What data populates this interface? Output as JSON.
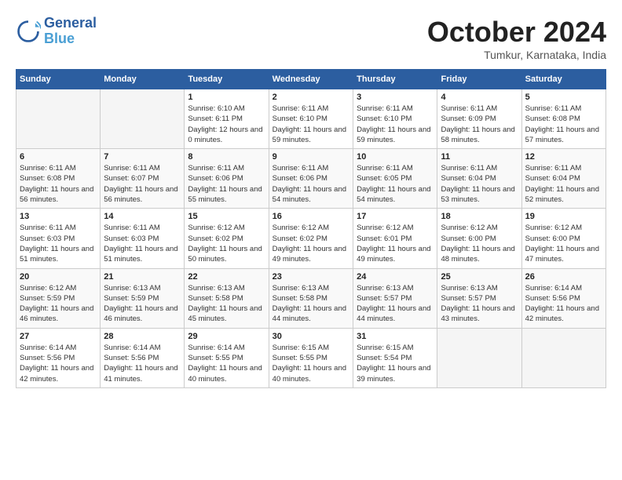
{
  "header": {
    "logo_line1": "General",
    "logo_line2": "Blue",
    "month": "October 2024",
    "location": "Tumkur, Karnataka, India"
  },
  "days_of_week": [
    "Sunday",
    "Monday",
    "Tuesday",
    "Wednesday",
    "Thursday",
    "Friday",
    "Saturday"
  ],
  "weeks": [
    [
      {
        "day": "",
        "empty": true
      },
      {
        "day": "",
        "empty": true
      },
      {
        "day": "1",
        "sunrise": "6:10 AM",
        "sunset": "6:11 PM",
        "daylight": "12 hours and 0 minutes."
      },
      {
        "day": "2",
        "sunrise": "6:11 AM",
        "sunset": "6:10 PM",
        "daylight": "11 hours and 59 minutes."
      },
      {
        "day": "3",
        "sunrise": "6:11 AM",
        "sunset": "6:10 PM",
        "daylight": "11 hours and 59 minutes."
      },
      {
        "day": "4",
        "sunrise": "6:11 AM",
        "sunset": "6:09 PM",
        "daylight": "11 hours and 58 minutes."
      },
      {
        "day": "5",
        "sunrise": "6:11 AM",
        "sunset": "6:08 PM",
        "daylight": "11 hours and 57 minutes."
      }
    ],
    [
      {
        "day": "6",
        "sunrise": "6:11 AM",
        "sunset": "6:08 PM",
        "daylight": "11 hours and 56 minutes."
      },
      {
        "day": "7",
        "sunrise": "6:11 AM",
        "sunset": "6:07 PM",
        "daylight": "11 hours and 56 minutes."
      },
      {
        "day": "8",
        "sunrise": "6:11 AM",
        "sunset": "6:06 PM",
        "daylight": "11 hours and 55 minutes."
      },
      {
        "day": "9",
        "sunrise": "6:11 AM",
        "sunset": "6:06 PM",
        "daylight": "11 hours and 54 minutes."
      },
      {
        "day": "10",
        "sunrise": "6:11 AM",
        "sunset": "6:05 PM",
        "daylight": "11 hours and 54 minutes."
      },
      {
        "day": "11",
        "sunrise": "6:11 AM",
        "sunset": "6:04 PM",
        "daylight": "11 hours and 53 minutes."
      },
      {
        "day": "12",
        "sunrise": "6:11 AM",
        "sunset": "6:04 PM",
        "daylight": "11 hours and 52 minutes."
      }
    ],
    [
      {
        "day": "13",
        "sunrise": "6:11 AM",
        "sunset": "6:03 PM",
        "daylight": "11 hours and 51 minutes."
      },
      {
        "day": "14",
        "sunrise": "6:11 AM",
        "sunset": "6:03 PM",
        "daylight": "11 hours and 51 minutes."
      },
      {
        "day": "15",
        "sunrise": "6:12 AM",
        "sunset": "6:02 PM",
        "daylight": "11 hours and 50 minutes."
      },
      {
        "day": "16",
        "sunrise": "6:12 AM",
        "sunset": "6:02 PM",
        "daylight": "11 hours and 49 minutes."
      },
      {
        "day": "17",
        "sunrise": "6:12 AM",
        "sunset": "6:01 PM",
        "daylight": "11 hours and 49 minutes."
      },
      {
        "day": "18",
        "sunrise": "6:12 AM",
        "sunset": "6:00 PM",
        "daylight": "11 hours and 48 minutes."
      },
      {
        "day": "19",
        "sunrise": "6:12 AM",
        "sunset": "6:00 PM",
        "daylight": "11 hours and 47 minutes."
      }
    ],
    [
      {
        "day": "20",
        "sunrise": "6:12 AM",
        "sunset": "5:59 PM",
        "daylight": "11 hours and 46 minutes."
      },
      {
        "day": "21",
        "sunrise": "6:13 AM",
        "sunset": "5:59 PM",
        "daylight": "11 hours and 46 minutes."
      },
      {
        "day": "22",
        "sunrise": "6:13 AM",
        "sunset": "5:58 PM",
        "daylight": "11 hours and 45 minutes."
      },
      {
        "day": "23",
        "sunrise": "6:13 AM",
        "sunset": "5:58 PM",
        "daylight": "11 hours and 44 minutes."
      },
      {
        "day": "24",
        "sunrise": "6:13 AM",
        "sunset": "5:57 PM",
        "daylight": "11 hours and 44 minutes."
      },
      {
        "day": "25",
        "sunrise": "6:13 AM",
        "sunset": "5:57 PM",
        "daylight": "11 hours and 43 minutes."
      },
      {
        "day": "26",
        "sunrise": "6:14 AM",
        "sunset": "5:56 PM",
        "daylight": "11 hours and 42 minutes."
      }
    ],
    [
      {
        "day": "27",
        "sunrise": "6:14 AM",
        "sunset": "5:56 PM",
        "daylight": "11 hours and 42 minutes."
      },
      {
        "day": "28",
        "sunrise": "6:14 AM",
        "sunset": "5:56 PM",
        "daylight": "11 hours and 41 minutes."
      },
      {
        "day": "29",
        "sunrise": "6:14 AM",
        "sunset": "5:55 PM",
        "daylight": "11 hours and 40 minutes."
      },
      {
        "day": "30",
        "sunrise": "6:15 AM",
        "sunset": "5:55 PM",
        "daylight": "11 hours and 40 minutes."
      },
      {
        "day": "31",
        "sunrise": "6:15 AM",
        "sunset": "5:54 PM",
        "daylight": "11 hours and 39 minutes."
      },
      {
        "day": "",
        "empty": true
      },
      {
        "day": "",
        "empty": true
      }
    ]
  ]
}
